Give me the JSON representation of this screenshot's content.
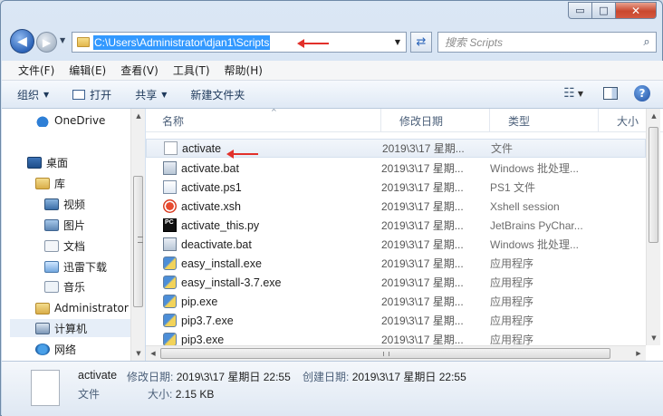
{
  "window": {
    "min_glyph": "▭",
    "max_glyph": "□",
    "close_glyph": "✕"
  },
  "nav": {
    "back_glyph": "◀",
    "forward_glyph": "▶",
    "address": "C:\\Users\\Administrator\\djan1\\Scripts",
    "refresh_glyph": "⇄",
    "search_placeholder": "搜索 Scripts",
    "search_icon": "search-icon"
  },
  "menu": [
    "文件(F)",
    "编辑(E)",
    "查看(V)",
    "工具(T)",
    "帮助(H)"
  ],
  "toolbar": {
    "organize": "组织",
    "open": "打开",
    "share": "共享",
    "new_folder": "新建文件夹"
  },
  "tree": [
    {
      "label": "OneDrive",
      "icon": "onedrive-icon"
    },
    {
      "label": "桌面",
      "icon": "desktop-icon"
    },
    {
      "label": "库",
      "icon": "library-icon"
    },
    {
      "label": "视频",
      "icon": "video-icon"
    },
    {
      "label": "图片",
      "icon": "pictures-icon"
    },
    {
      "label": "文档",
      "icon": "documents-icon"
    },
    {
      "label": "迅雷下载",
      "icon": "download-icon"
    },
    {
      "label": "音乐",
      "icon": "music-icon"
    },
    {
      "label": "Administrator",
      "icon": "user-folder-icon"
    },
    {
      "label": "计算机",
      "icon": "computer-icon"
    },
    {
      "label": "网络",
      "icon": "network-icon"
    }
  ],
  "columns": [
    "名称",
    "修改日期",
    "类型",
    "大小"
  ],
  "files": [
    {
      "name": "activate",
      "date": "2019\\3\\17 星期...",
      "type": "文件",
      "icon": "blank-file-icon"
    },
    {
      "name": "activate.bat",
      "date": "2019\\3\\17 星期...",
      "type": "Windows 批处理...",
      "icon": "bat-file-icon"
    },
    {
      "name": "activate.ps1",
      "date": "2019\\3\\17 星期...",
      "type": "PS1 文件",
      "icon": "ps1-file-icon"
    },
    {
      "name": "activate.xsh",
      "date": "2019\\3\\17 星期...",
      "type": "Xshell session",
      "icon": "xshell-file-icon"
    },
    {
      "name": "activate_this.py",
      "date": "2019\\3\\17 星期...",
      "type": "JetBrains PyChar...",
      "icon": "pycharm-file-icon"
    },
    {
      "name": "deactivate.bat",
      "date": "2019\\3\\17 星期...",
      "type": "Windows 批处理...",
      "icon": "bat-file-icon"
    },
    {
      "name": "easy_install.exe",
      "date": "2019\\3\\17 星期...",
      "type": "应用程序",
      "icon": "exe-file-icon"
    },
    {
      "name": "easy_install-3.7.exe",
      "date": "2019\\3\\17 星期...",
      "type": "应用程序",
      "icon": "exe-file-icon"
    },
    {
      "name": "pip.exe",
      "date": "2019\\3\\17 星期...",
      "type": "应用程序",
      "icon": "exe-file-icon"
    },
    {
      "name": "pip3.7.exe",
      "date": "2019\\3\\17 星期...",
      "type": "应用程序",
      "icon": "exe-file-icon"
    },
    {
      "name": "pip3.exe",
      "date": "2019\\3\\17 星期...",
      "type": "应用程序",
      "icon": "exe-file-icon"
    }
  ],
  "details": {
    "name": "activate",
    "kind": "文件",
    "modified_label": "修改日期:",
    "modified_value": "2019\\3\\17 星期日 22:55",
    "created_label": "创建日期:",
    "created_value": "2019\\3\\17 星期日 22:55",
    "size_label": "大小:",
    "size_value": "2.15 KB"
  },
  "colors": {
    "accent": "#3399ff",
    "annotation_arrow": "#e2302a"
  }
}
